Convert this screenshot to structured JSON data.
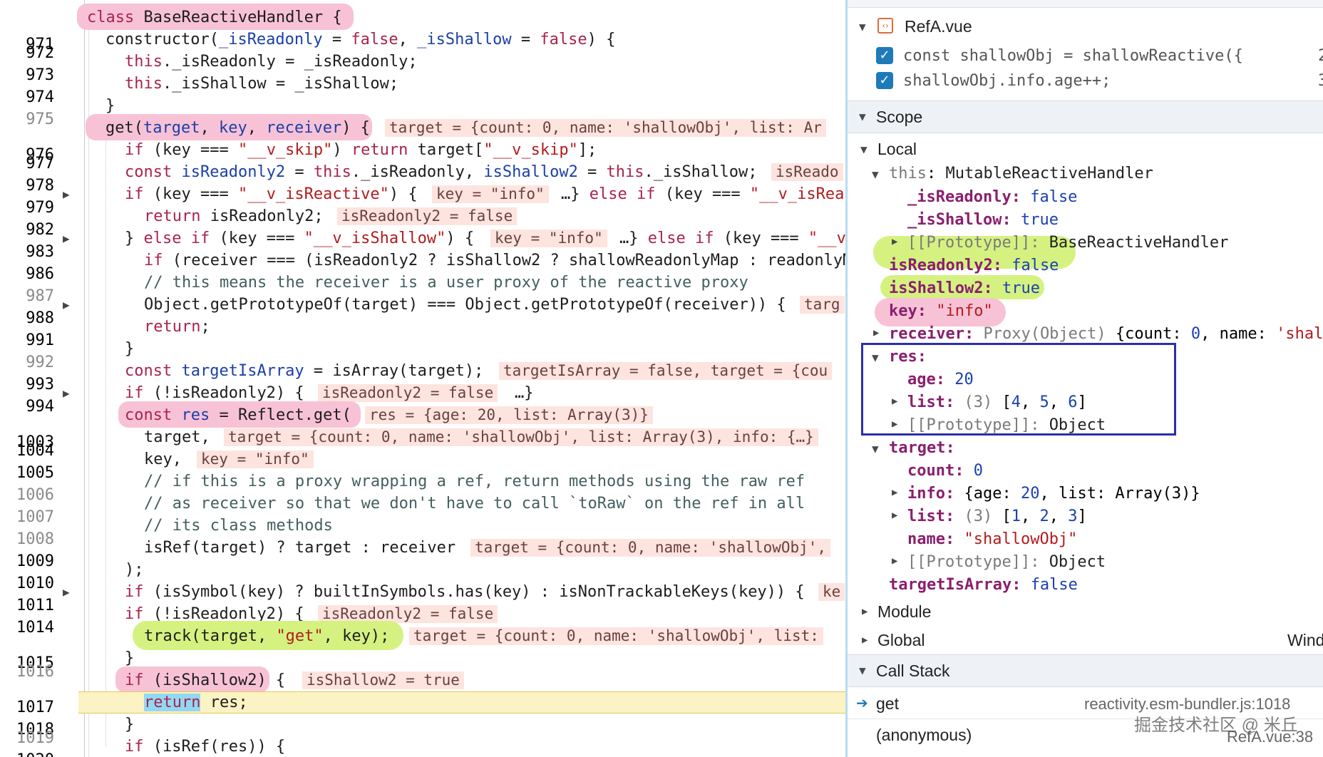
{
  "editor": {
    "lines": [
      {
        "n": "971",
        "arrow": ""
      },
      {
        "n": "972",
        "arrow": ""
      },
      {
        "n": "973",
        "arrow": ""
      },
      {
        "n": "974",
        "arrow": ""
      },
      {
        "n": "975",
        "arrow": ""
      },
      {
        "n": "976",
        "arrow": ""
      },
      {
        "n": "977",
        "arrow": ""
      },
      {
        "n": "978",
        "arrow": ""
      },
      {
        "n": "979",
        "arrow": "▶"
      },
      {
        "n": "982",
        "arrow": ""
      },
      {
        "n": "983",
        "arrow": "▶"
      },
      {
        "n": "986",
        "arrow": ""
      },
      {
        "n": "987",
        "arrow": ""
      },
      {
        "n": "988",
        "arrow": "▶"
      },
      {
        "n": "991",
        "arrow": ""
      },
      {
        "n": "992",
        "arrow": ""
      },
      {
        "n": "993",
        "arrow": ""
      },
      {
        "n": "994",
        "arrow": "▶"
      },
      {
        "n": "1003",
        "arrow": ""
      },
      {
        "n": "1004",
        "arrow": ""
      },
      {
        "n": "1005",
        "arrow": ""
      },
      {
        "n": "1006",
        "arrow": ""
      },
      {
        "n": "1007",
        "arrow": ""
      },
      {
        "n": "1008",
        "arrow": ""
      },
      {
        "n": "1009",
        "arrow": ""
      },
      {
        "n": "1010",
        "arrow": ""
      },
      {
        "n": "1011",
        "arrow": "▶"
      },
      {
        "n": "1014",
        "arrow": ""
      },
      {
        "n": "1015",
        "arrow": ""
      },
      {
        "n": "1016",
        "arrow": ""
      },
      {
        "n": "1017",
        "arrow": ""
      },
      {
        "n": "1018",
        "arrow": ""
      },
      {
        "n": "1019",
        "arrow": ""
      },
      {
        "n": "1020",
        "arrow": ""
      }
    ],
    "code": {
      "l971": {
        "a": "class ",
        "b": "BaseReactiveHandler",
        "c": " {"
      },
      "l972": {
        "a": "constructor(",
        "b": "_isReadonly",
        "c": " = ",
        "d": "false",
        "e": ", ",
        "f": "_isShallow",
        "g": " = ",
        "h": "false",
        "i": ") {"
      },
      "l973": {
        "a": "this",
        "b": "._isReadonly = _isReadonly;"
      },
      "l974": {
        "a": "this",
        "b": "._isShallow = _isShallow;"
      },
      "l975": {
        "a": "}"
      },
      "l976": {
        "a": "get(",
        "b": "target",
        "c": ", ",
        "d": "key",
        "e": ", ",
        "f": "receiver",
        "g": ") {",
        "inline": "target = {count: 0, name: 'shallowObj', list: Ar"
      },
      "l977": {
        "a": "if",
        "b": " (key === ",
        "c": "\"__v_skip\"",
        "d": ") ",
        "e": "return",
        "f": " target[",
        "g": "\"__v_skip\"",
        "h": "];"
      },
      "l978": {
        "a": "const ",
        "b": "isReadonly2",
        "c": " = ",
        "d": "this",
        "e": "._isReadonly, ",
        "f": "isShallow2",
        "g": " = ",
        "h": "this",
        "i": "._isShallow;",
        "inline": "isReado"
      },
      "l979": {
        "a": "if",
        "b": " (key === ",
        "c": "\"__v_isReactive\"",
        "d": ") {",
        "inline": "key = \"info\"",
        "e": "…} ",
        "f": "else if",
        "g": " (key === ",
        "h": "\"__v_isRea"
      },
      "l982": {
        "a": "return",
        "b": " isReadonly2;",
        "inline": "isReadonly2 = false"
      },
      "l983": {
        "a": "} ",
        "b": "else if",
        "c": " (key === ",
        "d": "\"__v_isShallow\"",
        "e": ") {",
        "inline": "key = \"info\"",
        "f": "…} ",
        "g": "else if",
        "h": " (key === ",
        "i": "\"__v"
      },
      "l986": {
        "a": "if",
        "b": " (receiver === (isReadonly2 ? isShallow2 ? shallowReadonlyMap : readonlyM"
      },
      "l987": {
        "a": "// this means the receiver is a user proxy of the reactive proxy"
      },
      "l988": {
        "a": "Object.getPrototypeOf(target) === Object.getPrototypeOf(receiver)) {",
        "inline": "targ"
      },
      "l991": {
        "a": "return",
        "b": ";"
      },
      "l992": {
        "a": "}"
      },
      "l993": {
        "a": "const ",
        "b": "targetIsArray",
        "c": " = isArray(target);",
        "inline": "targetIsArray = false, target = {cou"
      },
      "l994": {
        "a": "if",
        "b": " (!isReadonly2) {",
        "inline": "isReadonly2 = false",
        "c": "…}"
      },
      "l1003": {
        "a": "const ",
        "b": "res",
        "c": " = Reflect.get(",
        "inline": "res = {age: 20, list: Array(3)}"
      },
      "l1004": {
        "a": "target,",
        "inline": "target = {count: 0, name: 'shallowObj', list: Array(3), info: {…}"
      },
      "l1005": {
        "a": "key,",
        "inline": "key = \"info\""
      },
      "l1006": {
        "a": "// if this is a proxy wrapping a ref, return methods using the raw ref"
      },
      "l1007": {
        "a": "// as receiver so that we don't have to call `toRaw` on the ref in all"
      },
      "l1008": {
        "a": "// its class methods"
      },
      "l1009": {
        "a": "isRef(target) ? target : receiver",
        "inline": "target = {count: 0, name: 'shallowObj',"
      },
      "l1010": {
        "a": ");"
      },
      "l1011": {
        "a": "if",
        "b": " (isSymbol(key) ? builtInSymbols.has(key) : isNonTrackableKeys(key)) {",
        "inline": "ke"
      },
      "l1014": {
        "a": "if",
        "b": " (!isReadonly2) {",
        "inline": "isReadonly2 = false"
      },
      "l1015": {
        "a": "track(target, ",
        "b": "\"get\"",
        "c": ", key);",
        "inline": "target = {count: 0, name: 'shallowObj', list:"
      },
      "l1016": {
        "a": "}"
      },
      "l1017": {
        "a": "if",
        "b": " (isShallow2) {",
        "inline": "isShallow2 = true"
      },
      "l1018": {
        "a": "return",
        "b": " res;"
      },
      "l1019": {
        "a": "}"
      },
      "l1020": {
        "a": "if",
        "b": " (isRef(res)) {"
      }
    }
  },
  "panel": {
    "file": {
      "name": "RefA.vue",
      "icon": "vue-file-icon"
    },
    "breakpoints": [
      {
        "text": "const shallowObj = shallowReactive({",
        "line": "2",
        "checked": true
      },
      {
        "text": "shallowObj.info.age++;",
        "line": "3",
        "checked": true
      }
    ],
    "scope_label": "Scope",
    "local_label": "Local",
    "this_row": {
      "key": "this",
      "sep": ": ",
      "value": "MutableReactiveHandler"
    },
    "this_children": [
      {
        "key": "_isReadonly",
        "value": "false"
      },
      {
        "key": "_isShallow",
        "value": "true"
      }
    ],
    "proto1": {
      "key": "[[Prototype]]",
      "value": "BaseReactiveHandler"
    },
    "isReadonly2": {
      "key": "isReadonly2",
      "value": "false"
    },
    "isShallow2": {
      "key": "isShallow2",
      "value": "true"
    },
    "key_var": {
      "key": "key",
      "value": "\"info\""
    },
    "receiver": {
      "key": "receiver",
      "value": "Proxy(Object)",
      "rest": " {count: ",
      "num": "0",
      "rest2": ", name: ",
      "str": "'shal"
    },
    "res": {
      "key": "res",
      "age_key": "age",
      "age_val": "20",
      "list_key": "list",
      "list_len": "(3)",
      "list_open": "[",
      "list_vals": [
        "4",
        "5",
        "6"
      ],
      "list_close": "]",
      "proto_key": "[[Prototype]]",
      "proto_val": "Object"
    },
    "target": {
      "key": "target",
      "count_key": "count",
      "count_val": "0",
      "info_key": "info",
      "info_open": "{age: ",
      "info_age": "20",
      "info_mid": ", list: Array(3)}",
      "list_key": "list",
      "list_len": "(3)",
      "list_open": "[",
      "list_vals": [
        "1",
        "2",
        "3"
      ],
      "list_close": "]",
      "name_key": "name",
      "name_val": "\"shallowObj\"",
      "proto_key": "[[Prototype]]",
      "proto_val": "Object"
    },
    "targetIsArray": {
      "key": "targetIsArray",
      "value": "false"
    },
    "module_label": "Module",
    "global_label": "Global",
    "global_value": "Wind",
    "callstack_label": "Call Stack",
    "frames": [
      {
        "name": "get",
        "location": "reactivity.esm-bundler.js:1018"
      },
      {
        "name": "(anonymous)",
        "location": "RefA.vue:38"
      }
    ],
    "watermark": "掘金技术社区 @ 米丘"
  },
  "colors": {
    "keyword": "#a8244b",
    "function": "#1b40a8",
    "string": "#b31c1c",
    "prop": "#8a1f6e",
    "pink_pill": "#f8c2d6",
    "green_pill": "#d5f281",
    "exec_line": "#fbf3c4",
    "box": "#2c2fa8"
  }
}
